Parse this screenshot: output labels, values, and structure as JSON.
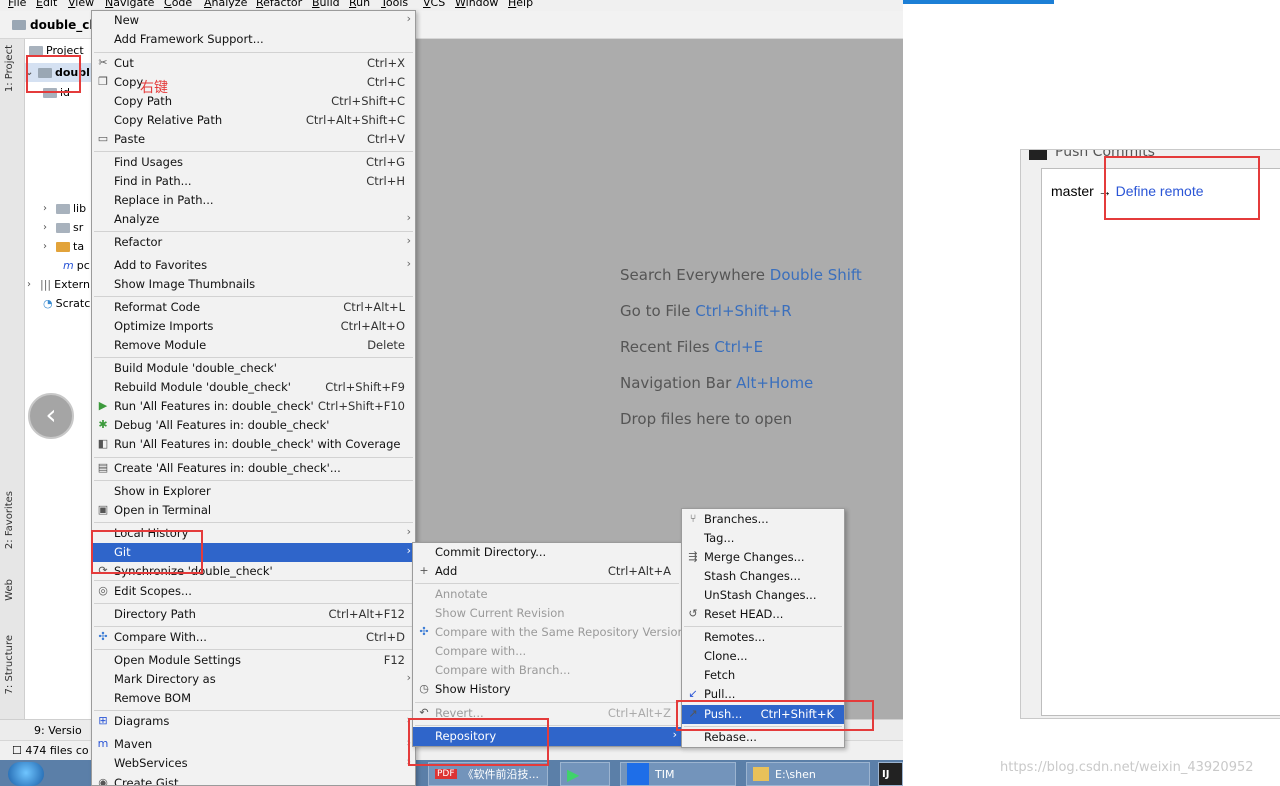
{
  "ide": {
    "menubar": [
      "File",
      "Edit",
      "View",
      "Navigate",
      "Code",
      "Analyze",
      "Refactor",
      "Build",
      "Run",
      "Tools",
      "VCS",
      "Window",
      "Help"
    ],
    "breadcrumb": "double_che",
    "tree": {
      "header": "Project",
      "root": "doubl",
      "child": "id",
      "libs": "lib",
      "src": "sr",
      "target": "ta",
      "pom": "pc",
      "external": "Extern",
      "scratches": "Scratc"
    },
    "tool_tabs": {
      "project": "1: Project",
      "favorites": "2: Favorites",
      "web": "Web",
      "structure": "7: Structure"
    },
    "editor_hints": [
      {
        "text": "Search Everywhere",
        "key": "Double Shift"
      },
      {
        "text": "Go to File",
        "key": "Ctrl+Shift+R"
      },
      {
        "text": "Recent Files",
        "key": "Ctrl+E"
      },
      {
        "text": "Navigation Bar",
        "key": "Alt+Home"
      },
      {
        "text": "Drop files here to open",
        "key": ""
      }
    ],
    "status": {
      "version_control": "9: Versio",
      "files": "474 files co"
    }
  },
  "context_menu": {
    "items": [
      {
        "label": "New",
        "shortcut": "",
        "submenu": true
      },
      {
        "label": "Add Framework Support...",
        "shortcut": ""
      },
      {
        "label": "Cut",
        "shortcut": "Ctrl+X",
        "icon": "scissors-icon"
      },
      {
        "label": "Copy",
        "shortcut": "Ctrl+C",
        "icon": "copy-icon"
      },
      {
        "label": "Copy Path",
        "shortcut": "Ctrl+Shift+C"
      },
      {
        "label": "Copy Relative Path",
        "shortcut": "Ctrl+Alt+Shift+C"
      },
      {
        "label": "Paste",
        "shortcut": "Ctrl+V",
        "icon": "paste-icon"
      },
      {
        "label": "Find Usages",
        "shortcut": "Ctrl+G"
      },
      {
        "label": "Find in Path...",
        "shortcut": "Ctrl+H"
      },
      {
        "label": "Replace in Path...",
        "shortcut": ""
      },
      {
        "label": "Analyze",
        "shortcut": "",
        "submenu": true
      },
      {
        "label": "Refactor",
        "shortcut": "",
        "submenu": true
      },
      {
        "label": "Add to Favorites",
        "shortcut": "",
        "submenu": true
      },
      {
        "label": "Show Image Thumbnails",
        "shortcut": ""
      },
      {
        "label": "Reformat Code",
        "shortcut": "Ctrl+Alt+L"
      },
      {
        "label": "Optimize Imports",
        "shortcut": "Ctrl+Alt+O"
      },
      {
        "label": "Remove Module",
        "shortcut": "Delete"
      },
      {
        "label": "Build Module 'double_check'",
        "shortcut": ""
      },
      {
        "label": "Rebuild Module 'double_check'",
        "shortcut": "Ctrl+Shift+F9"
      },
      {
        "label": "Run 'All Features in: double_check'",
        "shortcut": "Ctrl+Shift+F10",
        "icon": "run-icon"
      },
      {
        "label": "Debug 'All Features in: double_check'",
        "shortcut": "",
        "icon": "debug-icon"
      },
      {
        "label": "Run 'All Features in: double_check' with Coverage",
        "shortcut": "",
        "icon": "coverage-icon"
      },
      {
        "label": "Create 'All Features in: double_check'...",
        "shortcut": "",
        "icon": "create-config-icon"
      },
      {
        "label": "Show in Explorer",
        "shortcut": ""
      },
      {
        "label": "Open in Terminal",
        "shortcut": "",
        "icon": "terminal-icon"
      },
      {
        "label": "Local History",
        "shortcut": "",
        "submenu": true
      },
      {
        "label": "Git",
        "shortcut": "",
        "submenu": true
      },
      {
        "label": "Synchronize 'double_check'",
        "shortcut": "",
        "icon": "sync-icon"
      },
      {
        "label": "Edit Scopes...",
        "shortcut": "",
        "icon": "scopes-icon"
      },
      {
        "label": "Directory Path",
        "shortcut": "Ctrl+Alt+F12"
      },
      {
        "label": "Compare With...",
        "shortcut": "Ctrl+D",
        "icon": "compare-icon"
      },
      {
        "label": "Open Module Settings",
        "shortcut": "F12"
      },
      {
        "label": "Mark Directory as",
        "shortcut": "",
        "submenu": true
      },
      {
        "label": "Remove BOM",
        "shortcut": ""
      },
      {
        "label": "Diagrams",
        "shortcut": "",
        "submenu": true,
        "icon": "diagram-icon"
      },
      {
        "label": "Maven",
        "shortcut": "",
        "submenu": true,
        "icon": "maven-icon"
      },
      {
        "label": "WebServices",
        "shortcut": "",
        "submenu": true
      },
      {
        "label": "Create Gist...",
        "shortcut": "",
        "icon": "github-icon"
      }
    ]
  },
  "git_menu": {
    "items": [
      {
        "label": "Commit Directory...",
        "shortcut": "",
        "disabled": false
      },
      {
        "label": "Add",
        "shortcut": "Ctrl+Alt+A",
        "disabled": false,
        "icon": "plus-icon"
      },
      {
        "label": "Annotate",
        "shortcut": "",
        "disabled": true
      },
      {
        "label": "Show Current Revision",
        "shortcut": "",
        "disabled": true
      },
      {
        "label": "Compare with the Same Repository Version",
        "shortcut": "",
        "disabled": true,
        "icon": "compare-icon"
      },
      {
        "label": "Compare with...",
        "shortcut": "",
        "disabled": true
      },
      {
        "label": "Compare with Branch...",
        "shortcut": "",
        "disabled": true
      },
      {
        "label": "Show History",
        "shortcut": "",
        "disabled": false,
        "icon": "clock-icon"
      },
      {
        "label": "Revert...",
        "shortcut": "Ctrl+Alt+Z",
        "disabled": true,
        "icon": "revert-icon"
      },
      {
        "label": "Repository",
        "shortcut": "",
        "disabled": false,
        "submenu": true
      }
    ]
  },
  "repo_menu": {
    "items": [
      {
        "label": "Branches...",
        "shortcut": "",
        "icon": "branch-icon"
      },
      {
        "label": "Tag...",
        "shortcut": ""
      },
      {
        "label": "Merge Changes...",
        "shortcut": "",
        "icon": "merge-icon"
      },
      {
        "label": "Stash Changes...",
        "shortcut": ""
      },
      {
        "label": "UnStash Changes...",
        "shortcut": ""
      },
      {
        "label": "Reset HEAD...",
        "shortcut": "",
        "icon": "reset-icon"
      },
      {
        "label": "Remotes...",
        "shortcut": ""
      },
      {
        "label": "Clone...",
        "shortcut": ""
      },
      {
        "label": "Fetch",
        "shortcut": ""
      },
      {
        "label": "Pull...",
        "shortcut": "",
        "icon": "pull-icon"
      },
      {
        "label": "Push...",
        "shortcut": "Ctrl+Shift+K",
        "icon": "push-icon"
      },
      {
        "label": "Rebase...",
        "shortcut": ""
      }
    ]
  },
  "annotation": {
    "right_click_text": "右键"
  },
  "taskbar": {
    "items": [
      "《软件前沿技...",
      "",
      "TIM",
      "E:\\shen",
      "IJ"
    ]
  },
  "push_dialog": {
    "title": "Push Commits",
    "branch": "master",
    "arrow": "→",
    "link": "Define remote"
  },
  "watermark": "https://blog.csdn.net/weixin_43920952"
}
